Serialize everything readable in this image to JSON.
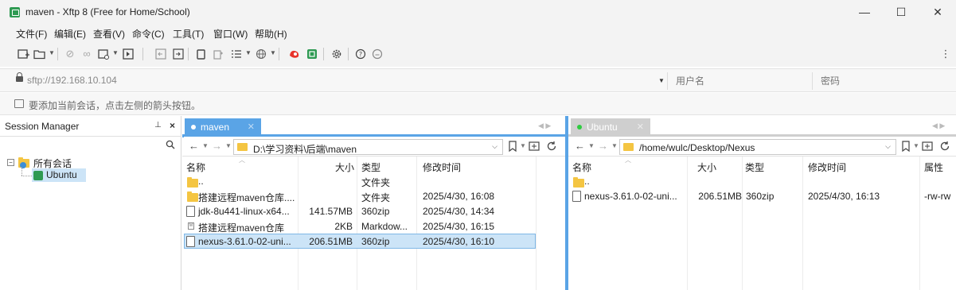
{
  "window": {
    "title": "maven - Xftp 8 (Free for Home/School)",
    "minimize_glyph": "—",
    "maximize_glyph": "☐",
    "close_glyph": "✕"
  },
  "menu": [
    "文件(F)",
    "编辑(E)",
    "查看(V)",
    "命令(C)",
    "工具(T)",
    "窗口(W)",
    "帮助(H)"
  ],
  "toolbar": {
    "icons": [
      "new-session-icon",
      "open-session-icon",
      "disconnect-icon",
      "link-icon",
      "new-tab-icon",
      "start-transfer-icon",
      "sync-left-icon",
      "sync-right-icon",
      "copy-icon",
      "paste-icon",
      "list-view-icon",
      "globe-icon",
      "xshell-icon",
      "xftp-icon",
      "settings-icon",
      "help-icon",
      "chat-icon"
    ],
    "more_glyph": "⋮"
  },
  "address": {
    "value": "sftp://192.168.10.104",
    "username_placeholder": "用户名",
    "password_placeholder": "密码"
  },
  "hint": "要添加当前会话，点击左侧的箭头按钮。",
  "session_manager": {
    "title": "Session Manager",
    "pin_glyph": "⊥",
    "close_glyph": "×",
    "tree": {
      "root": "所有会话",
      "child": "Ubuntu"
    }
  },
  "local": {
    "tab": "maven",
    "path": "D:\\学习资料\\后端\\maven",
    "columns": [
      "名称",
      "大小",
      "类型",
      "修改时间"
    ],
    "rows": [
      {
        "name": "..",
        "size": "",
        "type": "文件夹",
        "modified": "",
        "icon": "parent-folder-icon"
      },
      {
        "name": "搭建远程maven仓库....",
        "size": "",
        "type": "文件夹",
        "modified": "2025/4/30, 16:08",
        "icon": "folder-icon"
      },
      {
        "name": "jdk-8u441-linux-x64...",
        "size": "141.57MB",
        "type": "360zip",
        "modified": "2025/4/30, 14:34",
        "icon": "file-icon"
      },
      {
        "name": "搭建远程maven仓库",
        "size": "2KB",
        "type": "Markdow...",
        "modified": "2025/4/30, 16:15",
        "icon": "markdown-icon"
      },
      {
        "name": "nexus-3.61.0-02-uni...",
        "size": "206.51MB",
        "type": "360zip",
        "modified": "2025/4/30, 16:10",
        "icon": "file-icon"
      }
    ]
  },
  "remote": {
    "tab": "Ubuntu",
    "path": "/home/wulc/Desktop/Nexus",
    "columns": [
      "名称",
      "大小",
      "类型",
      "修改时间",
      "属性"
    ],
    "rows": [
      {
        "name": "..",
        "size": "",
        "type": "",
        "modified": "",
        "attr": "",
        "icon": "parent-folder-icon"
      },
      {
        "name": "nexus-3.61.0-02-uni...",
        "size": "206.51MB",
        "type": "360zip",
        "modified": "2025/4/30, 16:13",
        "attr": "-rw-rw",
        "icon": "file-icon"
      }
    ]
  },
  "colors": {
    "active_tab": "#5aa4e6",
    "inactive_tab": "#cfcfcf",
    "selection": "#cce4f7",
    "folder": "#f4c542",
    "connected_dot": "#2ecc40"
  }
}
